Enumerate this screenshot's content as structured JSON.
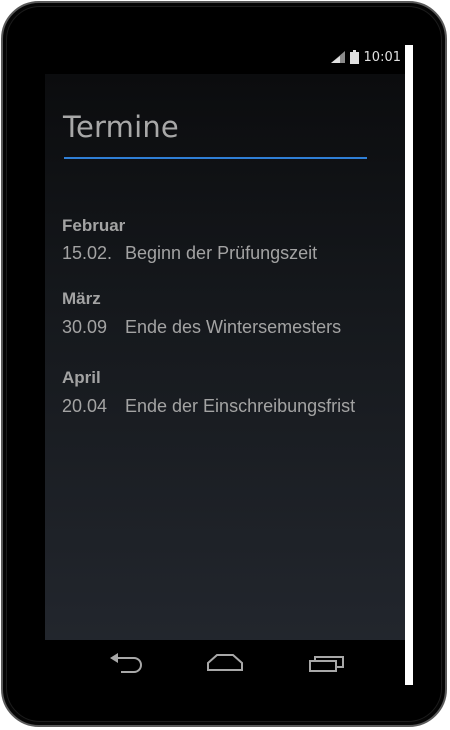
{
  "status_bar": {
    "time": "10:01",
    "icons": [
      "signal-icon",
      "battery-icon"
    ]
  },
  "app": {
    "title": "Termine"
  },
  "sections": [
    {
      "month": "Februar",
      "date": "15.02.",
      "event": "Beginn der Prüfungszeit"
    },
    {
      "month": "März",
      "date": "30.09",
      "event": "Ende des Wintersemesters"
    },
    {
      "month": "April",
      "date": "20.04",
      "event": "Ende der Einschreibungsfrist"
    }
  ],
  "nav_bar": {
    "buttons": [
      "back-icon",
      "home-icon",
      "recent-apps-icon"
    ]
  },
  "colors": {
    "accent": "#2f7fd6",
    "text": "#a3a3a3",
    "background_top": "#0b0c0e",
    "background_bottom": "#22262d"
  }
}
